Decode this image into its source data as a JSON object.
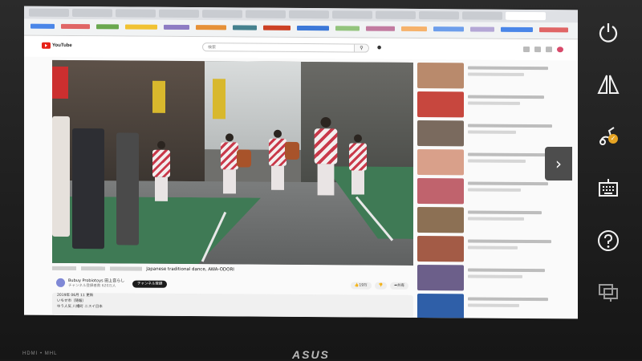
{
  "browser": {
    "tabs_count": 12,
    "bookmark_colors": [
      "#4a86e8",
      "#e06666",
      "#6aa84f",
      "#f1c232",
      "#8e7cc3",
      "#e69138",
      "#45818e",
      "#cc4125",
      "#3c78d8",
      "#93c47d",
      "#c27ba0",
      "#f6b26b",
      "#6d9eeb",
      "#b4a7d6"
    ]
  },
  "youtube": {
    "logo_text": "YouTube",
    "search_placeholder": "検索",
    "search_icon": "search-icon",
    "mic_icon": "mic-icon"
  },
  "video": {
    "title": "Japanese traditional dance, AWA-ODORI",
    "channel_name": "Bubuy Probiotoys 田上音らし",
    "channel_subs": "チャンネル登録者数 620万人",
    "subscribe_label": "チャンネル登録",
    "like_label": "19万",
    "dislike_label": "",
    "share_label": "共有",
    "desc_line1": "2019年 06月 11 更新",
    "desc_line2": "いちせ市（随報）",
    "desc_line3": "ゆう人気   八幡町    ニスイ日本"
  },
  "side_panel": {
    "items": [
      {
        "name": "power",
        "icon": "power-icon"
      },
      {
        "name": "display-mode",
        "icon": "triangle-split-icon"
      },
      {
        "name": "pen-settings",
        "icon": "pen-check-icon"
      },
      {
        "name": "keyboard",
        "icon": "keyboard-icon"
      },
      {
        "name": "help",
        "icon": "question-icon"
      },
      {
        "name": "screen",
        "icon": "monitor-icon"
      }
    ],
    "badge": "✓",
    "handle": "›"
  },
  "bezel": {
    "ports_text": "HDMI • MHL",
    "brand": "ASUS"
  },
  "colors": {
    "youtube_red": "#e62117",
    "side_badge": "#e6a423",
    "bezel": "#1e1e1e"
  }
}
